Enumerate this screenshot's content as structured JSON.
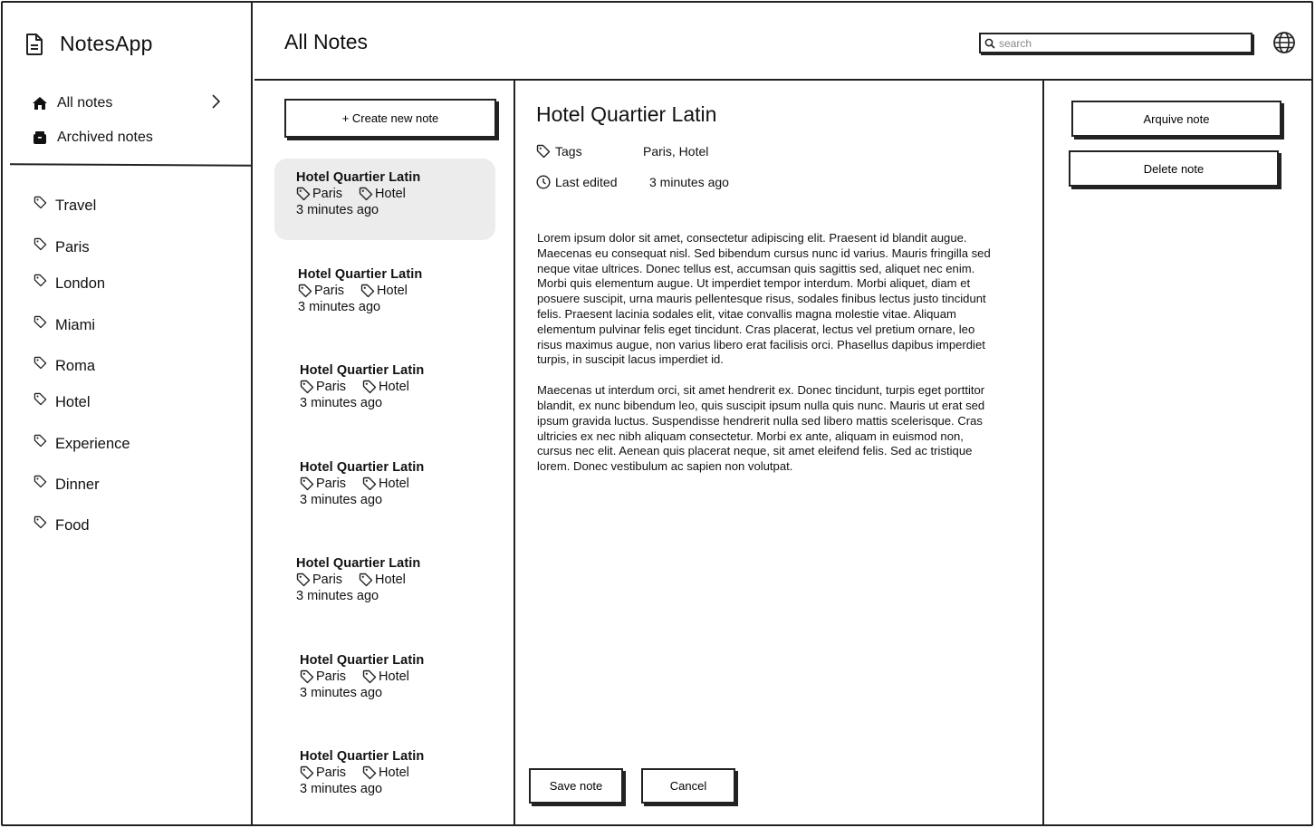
{
  "app": {
    "name": "NotesApp"
  },
  "sidebar": {
    "nav": [
      {
        "label": "All notes",
        "icon": "home-icon"
      },
      {
        "label": "Archived notes",
        "icon": "archive-icon"
      }
    ],
    "tags": [
      "Travel",
      "Paris",
      "London",
      "Miami",
      "Roma",
      "Hotel",
      "Experience",
      "Dinner",
      "Food"
    ]
  },
  "header": {
    "title": "All Notes",
    "search_placeholder": "search",
    "search_value": ""
  },
  "notes_list": {
    "create_label": "+ Create new note",
    "notes": [
      {
        "title": "Hotel Quartier Latin",
        "tags": [
          "Paris",
          "Hotel"
        ],
        "time": "3 minutes ago",
        "selected": true
      },
      {
        "title": "Hotel Quartier Latin",
        "tags": [
          "Paris",
          "Hotel"
        ],
        "time": "3 minutes ago"
      },
      {
        "title": "Hotel Quartier Latin",
        "tags": [
          "Paris",
          "Hotel"
        ],
        "time": "3 minutes ago"
      },
      {
        "title": "Hotel Quartier Latin",
        "tags": [
          "Paris",
          "Hotel"
        ],
        "time": "3 minutes ago"
      },
      {
        "title": "Hotel Quartier Latin",
        "tags": [
          "Paris",
          "Hotel"
        ],
        "time": "3 minutes ago"
      },
      {
        "title": "Hotel Quartier Latin",
        "tags": [
          "Paris",
          "Hotel"
        ],
        "time": "3 minutes ago"
      },
      {
        "title": "Hotel Quartier Latin",
        "tags": [
          "Paris",
          "Hotel"
        ],
        "time": "3 minutes ago"
      }
    ]
  },
  "detail": {
    "title": "Hotel Quartier Latin",
    "tags_label": "Tags",
    "tags_value": "Paris, Hotel",
    "edited_label": "Last edited",
    "edited_value": "3 minutes ago",
    "paragraphs": [
      "Lorem ipsum dolor sit amet, consectetur adipiscing elit. Praesent id blandit augue. Maecenas eu consequat nisl. Sed bibendum cursus nunc id varius. Mauris fringilla sed neque vitae ultrices. Donec tellus est, accumsan quis sagittis sed, aliquet nec enim. Morbi quis elementum augue. Ut imperdiet tempor interdum. Morbi aliquet, diam et posuere suscipit, urna mauris pellentesque risus, sodales finibus lectus justo tincidunt felis. Praesent lacinia sodales elit, vitae convallis magna molestie vitae. Aliquam elementum pulvinar felis eget tincidunt. Cras placerat, lectus vel pretium ornare, leo risus maximus augue, non varius libero erat facilisis orci. Phasellus dapibus imperdiet turpis, in suscipit lacus imperdiet id.",
      "Maecenas ut interdum orci, sit amet hendrerit ex. Donec tincidunt, turpis eget porttitor blandit, ex nunc bibendum leo, quis suscipit ipsum nulla quis nunc. Mauris ut erat sed ipsum gravida luctus. Suspendisse hendrerit nulla sed libero mattis scelerisque. Cras ultricies ex nec nibh aliquam consectetur. Morbi ex ante, aliquam in euismod non, cursus nec elit. Aenean quis placerat neque, sit amet eleifend felis. Sed ac tristique lorem. Donec vestibulum ac sapien non volutpat."
    ],
    "save_label": "Save note",
    "cancel_label": "Cancel"
  },
  "actions": {
    "archive_label": "Arquive note",
    "delete_label": "Delete note"
  }
}
